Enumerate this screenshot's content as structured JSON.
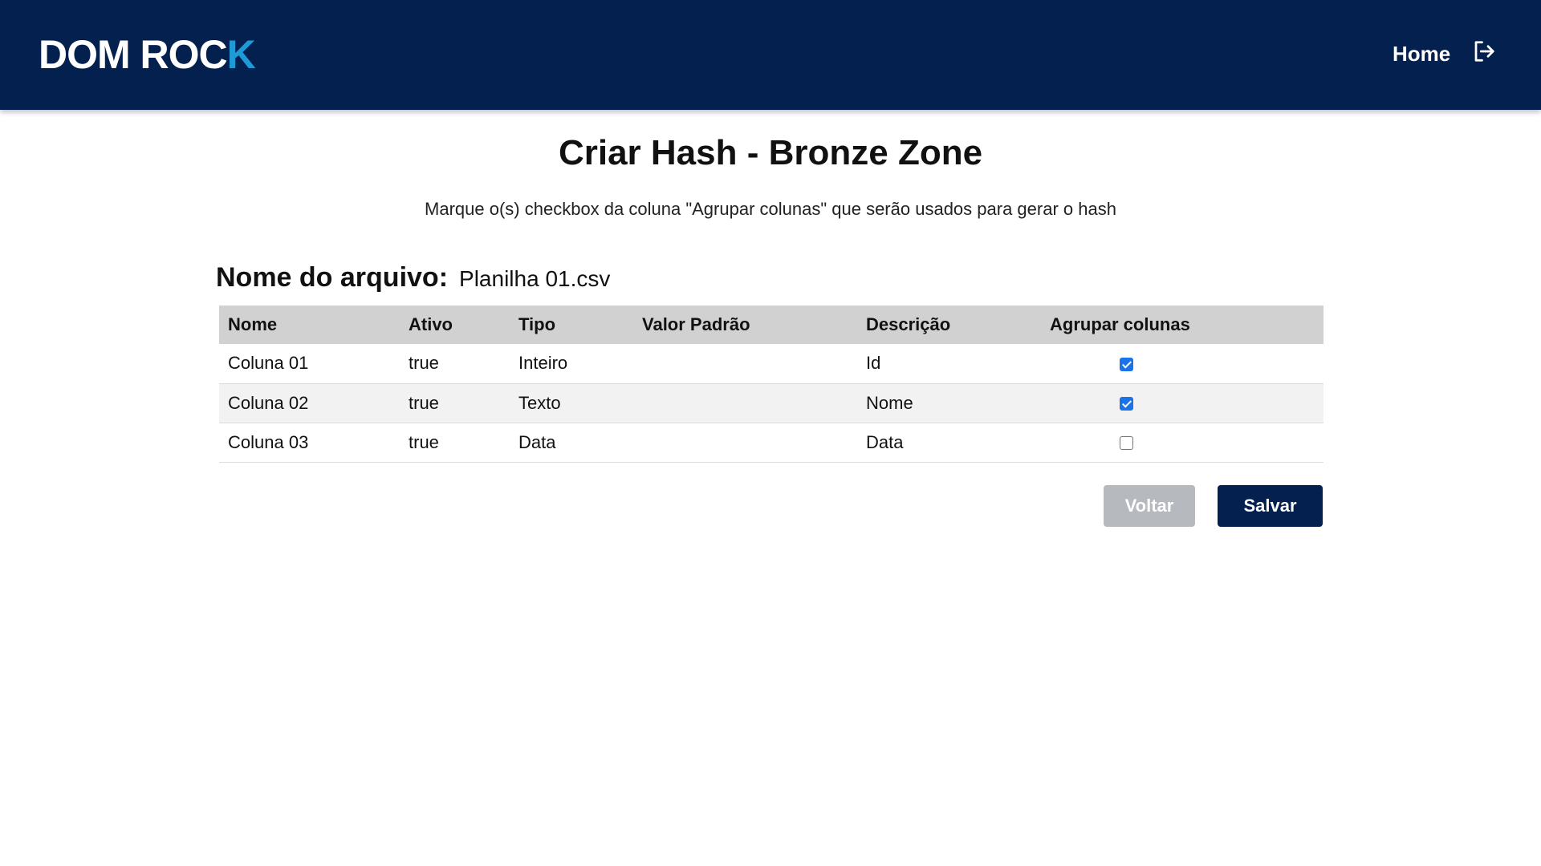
{
  "header": {
    "logo_main": "DOM ROC",
    "logo_accent": "K",
    "nav_home": "Home",
    "logout_icon": "logout-icon"
  },
  "page": {
    "title": "Criar Hash - Bronze Zone",
    "subtitle": "Marque o(s) checkbox da coluna \"Agrupar colunas\" que serão usados para gerar o hash"
  },
  "file": {
    "label": "Nome do arquivo:",
    "name": "Planilha 01.csv"
  },
  "table": {
    "headers": [
      "Nome",
      "Ativo",
      "Tipo",
      "Valor Padrão",
      "Descrição",
      "Agrupar colunas"
    ],
    "rows": [
      {
        "nome": "Coluna 01",
        "ativo": "true",
        "tipo": "Inteiro",
        "valor": "",
        "descricao": "Id",
        "agrupar": true
      },
      {
        "nome": "Coluna 02",
        "ativo": "true",
        "tipo": "Texto",
        "valor": "",
        "descricao": "Nome",
        "agrupar": true
      },
      {
        "nome": "Coluna 03",
        "ativo": "true",
        "tipo": "Data",
        "valor": "",
        "descricao": "Data",
        "agrupar": false
      }
    ]
  },
  "buttons": {
    "back": "Voltar",
    "save": "Salvar"
  },
  "colors": {
    "navbar": "#03204e",
    "logo_accent": "#1e9bd7",
    "checkbox_checked": "#1a73e8",
    "button_disabled": "#b6babe",
    "button_primary": "#03204e"
  }
}
